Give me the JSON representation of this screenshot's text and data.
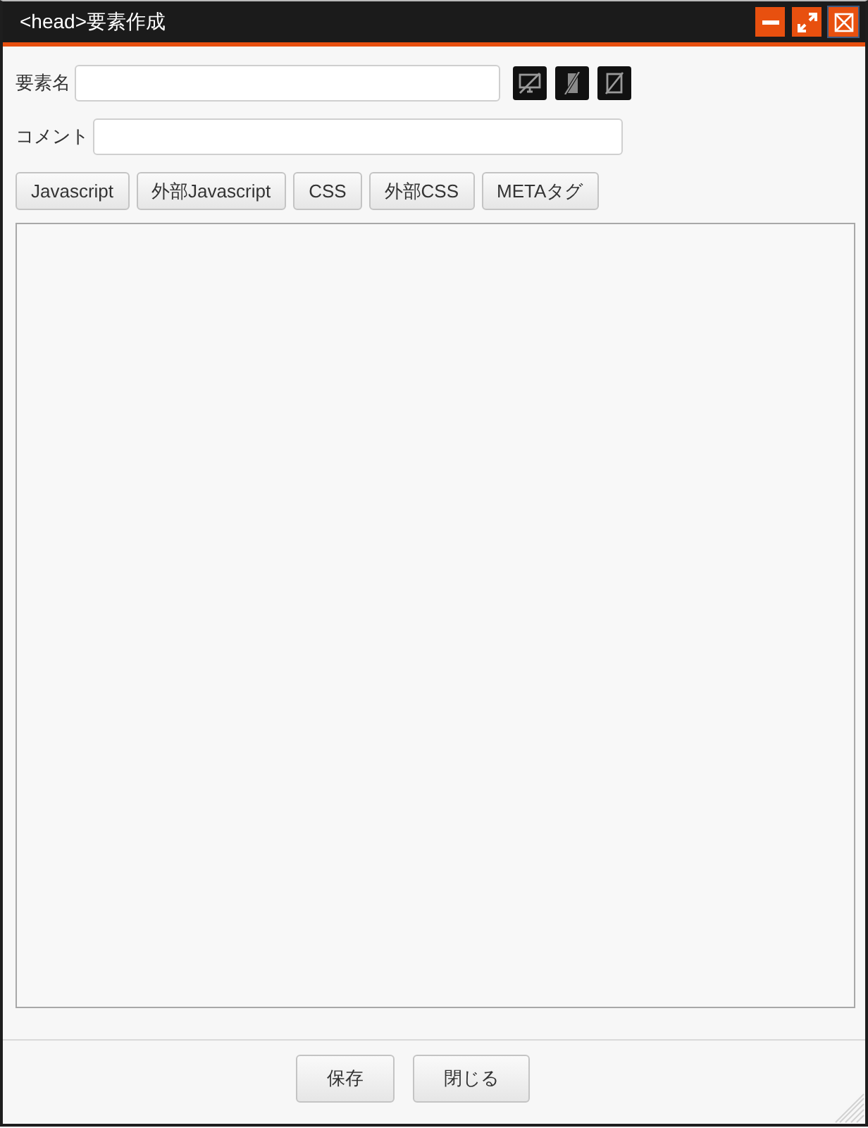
{
  "window": {
    "title": "<head>要素作成"
  },
  "fields": [
    {
      "kind": "name",
      "label": "要素名"
    },
    {
      "kind": "comment",
      "label": "コメント"
    }
  ],
  "tabs": [
    {
      "label": "Javascript",
      "selected": false
    },
    {
      "label": "外部Javascript",
      "selected": false
    },
    {
      "label": "CSS",
      "selected": false
    },
    {
      "label": "外部CSS",
      "selected": false
    },
    {
      "label": "METAタグ",
      "selected": false
    }
  ],
  "buttons": [
    "保存",
    "閉じる"
  ]
}
